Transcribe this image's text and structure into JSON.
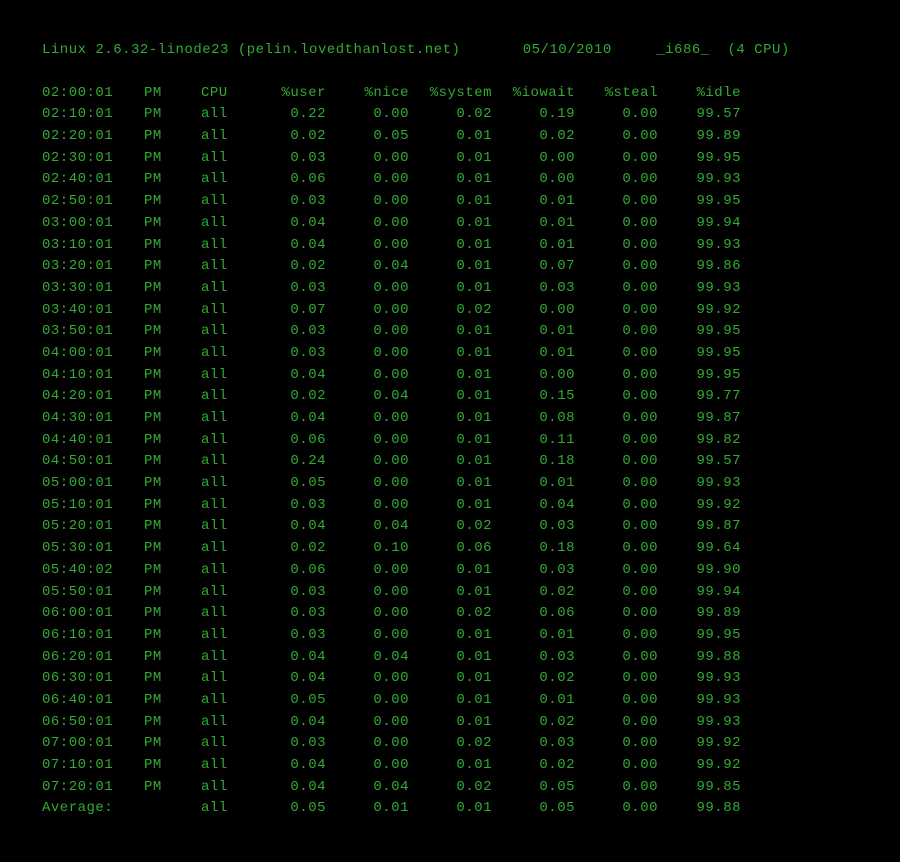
{
  "header": {
    "kernel": "Linux 2.6.32-linode23",
    "hostname": "(pelin.lovedthanlost.net)",
    "date": "05/10/2010",
    "arch": "_i686_",
    "cpu_info": "(4 CPU)"
  },
  "columns": {
    "time_heading": "02:00:01 PM",
    "cpu": "CPU",
    "user": "%user",
    "nice": "%nice",
    "system": "%system",
    "iowait": "%iowait",
    "steal": "%steal",
    "idle": "%idle"
  },
  "rows": [
    {
      "time": "02:10:01",
      "period": "PM",
      "cpu": "all",
      "user": "0.22",
      "nice": "0.00",
      "system": "0.02",
      "iowait": "0.19",
      "steal": "0.00",
      "idle": "99.57"
    },
    {
      "time": "02:20:01",
      "period": "PM",
      "cpu": "all",
      "user": "0.02",
      "nice": "0.05",
      "system": "0.01",
      "iowait": "0.02",
      "steal": "0.00",
      "idle": "99.89"
    },
    {
      "time": "02:30:01",
      "period": "PM",
      "cpu": "all",
      "user": "0.03",
      "nice": "0.00",
      "system": "0.01",
      "iowait": "0.00",
      "steal": "0.00",
      "idle": "99.95"
    },
    {
      "time": "02:40:01",
      "period": "PM",
      "cpu": "all",
      "user": "0.06",
      "nice": "0.00",
      "system": "0.01",
      "iowait": "0.00",
      "steal": "0.00",
      "idle": "99.93"
    },
    {
      "time": "02:50:01",
      "period": "PM",
      "cpu": "all",
      "user": "0.03",
      "nice": "0.00",
      "system": "0.01",
      "iowait": "0.01",
      "steal": "0.00",
      "idle": "99.95"
    },
    {
      "time": "03:00:01",
      "period": "PM",
      "cpu": "all",
      "user": "0.04",
      "nice": "0.00",
      "system": "0.01",
      "iowait": "0.01",
      "steal": "0.00",
      "idle": "99.94"
    },
    {
      "time": "03:10:01",
      "period": "PM",
      "cpu": "all",
      "user": "0.04",
      "nice": "0.00",
      "system": "0.01",
      "iowait": "0.01",
      "steal": "0.00",
      "idle": "99.93"
    },
    {
      "time": "03:20:01",
      "period": "PM",
      "cpu": "all",
      "user": "0.02",
      "nice": "0.04",
      "system": "0.01",
      "iowait": "0.07",
      "steal": "0.00",
      "idle": "99.86"
    },
    {
      "time": "03:30:01",
      "period": "PM",
      "cpu": "all",
      "user": "0.03",
      "nice": "0.00",
      "system": "0.01",
      "iowait": "0.03",
      "steal": "0.00",
      "idle": "99.93"
    },
    {
      "time": "03:40:01",
      "period": "PM",
      "cpu": "all",
      "user": "0.07",
      "nice": "0.00",
      "system": "0.02",
      "iowait": "0.00",
      "steal": "0.00",
      "idle": "99.92"
    },
    {
      "time": "03:50:01",
      "period": "PM",
      "cpu": "all",
      "user": "0.03",
      "nice": "0.00",
      "system": "0.01",
      "iowait": "0.01",
      "steal": "0.00",
      "idle": "99.95"
    },
    {
      "time": "04:00:01",
      "period": "PM",
      "cpu": "all",
      "user": "0.03",
      "nice": "0.00",
      "system": "0.01",
      "iowait": "0.01",
      "steal": "0.00",
      "idle": "99.95"
    },
    {
      "time": "04:10:01",
      "period": "PM",
      "cpu": "all",
      "user": "0.04",
      "nice": "0.00",
      "system": "0.01",
      "iowait": "0.00",
      "steal": "0.00",
      "idle": "99.95"
    },
    {
      "time": "04:20:01",
      "period": "PM",
      "cpu": "all",
      "user": "0.02",
      "nice": "0.04",
      "system": "0.01",
      "iowait": "0.15",
      "steal": "0.00",
      "idle": "99.77"
    },
    {
      "time": "04:30:01",
      "period": "PM",
      "cpu": "all",
      "user": "0.04",
      "nice": "0.00",
      "system": "0.01",
      "iowait": "0.08",
      "steal": "0.00",
      "idle": "99.87"
    },
    {
      "time": "04:40:01",
      "period": "PM",
      "cpu": "all",
      "user": "0.06",
      "nice": "0.00",
      "system": "0.01",
      "iowait": "0.11",
      "steal": "0.00",
      "idle": "99.82"
    },
    {
      "time": "04:50:01",
      "period": "PM",
      "cpu": "all",
      "user": "0.24",
      "nice": "0.00",
      "system": "0.01",
      "iowait": "0.18",
      "steal": "0.00",
      "idle": "99.57"
    },
    {
      "time": "05:00:01",
      "period": "PM",
      "cpu": "all",
      "user": "0.05",
      "nice": "0.00",
      "system": "0.01",
      "iowait": "0.01",
      "steal": "0.00",
      "idle": "99.93"
    },
    {
      "time": "05:10:01",
      "period": "PM",
      "cpu": "all",
      "user": "0.03",
      "nice": "0.00",
      "system": "0.01",
      "iowait": "0.04",
      "steal": "0.00",
      "idle": "99.92"
    },
    {
      "time": "05:20:01",
      "period": "PM",
      "cpu": "all",
      "user": "0.04",
      "nice": "0.04",
      "system": "0.02",
      "iowait": "0.03",
      "steal": "0.00",
      "idle": "99.87"
    },
    {
      "time": "05:30:01",
      "period": "PM",
      "cpu": "all",
      "user": "0.02",
      "nice": "0.10",
      "system": "0.06",
      "iowait": "0.18",
      "steal": "0.00",
      "idle": "99.64"
    },
    {
      "time": "05:40:02",
      "period": "PM",
      "cpu": "all",
      "user": "0.06",
      "nice": "0.00",
      "system": "0.01",
      "iowait": "0.03",
      "steal": "0.00",
      "idle": "99.90"
    },
    {
      "time": "05:50:01",
      "period": "PM",
      "cpu": "all",
      "user": "0.03",
      "nice": "0.00",
      "system": "0.01",
      "iowait": "0.02",
      "steal": "0.00",
      "idle": "99.94"
    },
    {
      "time": "06:00:01",
      "period": "PM",
      "cpu": "all",
      "user": "0.03",
      "nice": "0.00",
      "system": "0.02",
      "iowait": "0.06",
      "steal": "0.00",
      "idle": "99.89"
    },
    {
      "time": "06:10:01",
      "period": "PM",
      "cpu": "all",
      "user": "0.03",
      "nice": "0.00",
      "system": "0.01",
      "iowait": "0.01",
      "steal": "0.00",
      "idle": "99.95"
    },
    {
      "time": "06:20:01",
      "period": "PM",
      "cpu": "all",
      "user": "0.04",
      "nice": "0.04",
      "system": "0.01",
      "iowait": "0.03",
      "steal": "0.00",
      "idle": "99.88"
    },
    {
      "time": "06:30:01",
      "period": "PM",
      "cpu": "all",
      "user": "0.04",
      "nice": "0.00",
      "system": "0.01",
      "iowait": "0.02",
      "steal": "0.00",
      "idle": "99.93"
    },
    {
      "time": "06:40:01",
      "period": "PM",
      "cpu": "all",
      "user": "0.05",
      "nice": "0.00",
      "system": "0.01",
      "iowait": "0.01",
      "steal": "0.00",
      "idle": "99.93"
    },
    {
      "time": "06:50:01",
      "period": "PM",
      "cpu": "all",
      "user": "0.04",
      "nice": "0.00",
      "system": "0.01",
      "iowait": "0.02",
      "steal": "0.00",
      "idle": "99.93"
    },
    {
      "time": "07:00:01",
      "period": "PM",
      "cpu": "all",
      "user": "0.03",
      "nice": "0.00",
      "system": "0.02",
      "iowait": "0.03",
      "steal": "0.00",
      "idle": "99.92"
    },
    {
      "time": "07:10:01",
      "period": "PM",
      "cpu": "all",
      "user": "0.04",
      "nice": "0.00",
      "system": "0.01",
      "iowait": "0.02",
      "steal": "0.00",
      "idle": "99.92"
    },
    {
      "time": "07:20:01",
      "period": "PM",
      "cpu": "all",
      "user": "0.04",
      "nice": "0.04",
      "system": "0.02",
      "iowait": "0.05",
      "steal": "0.00",
      "idle": "99.85"
    }
  ],
  "average": {
    "label": "Average:",
    "cpu": "all",
    "user": "0.05",
    "nice": "0.01",
    "system": "0.01",
    "iowait": "0.05",
    "steal": "0.00",
    "idle": "99.88"
  }
}
